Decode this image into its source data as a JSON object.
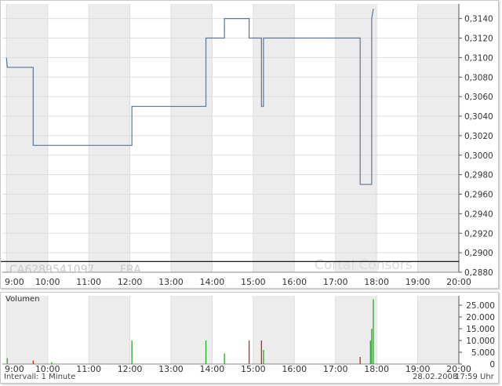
{
  "chart_data": [
    {
      "type": "line",
      "title": "",
      "identifier": "CA6289541097",
      "exchange": "FRA",
      "watermark": "Cortal Consors",
      "x_unit": "hours",
      "xlim": [
        8.9,
        20.0
      ],
      "ylim": [
        0.288,
        0.3155
      ],
      "x_tick_labels": [
        "9:00",
        "10:00",
        "11:00",
        "12:00",
        "13:00",
        "14:00",
        "15:00",
        "16:00",
        "17:00",
        "18:00",
        "19:00",
        "20:00"
      ],
      "y_tick_labels": [
        "0,2880",
        "0,2900",
        "0,2920",
        "0,2940",
        "0,2960",
        "0,2980",
        "0,3000",
        "0,3020",
        "0,3040",
        "0,3060",
        "0,3080",
        "0,3100",
        "0,3120",
        "0,3140"
      ],
      "reference_line": 0.2891,
      "grid": true,
      "series": [
        {
          "color": "#5b7596",
          "x": [
            9.0,
            9.02,
            9.65,
            9.65,
            12.05,
            12.05,
            13.85,
            13.85,
            14.3,
            14.3,
            14.9,
            14.9,
            15.2,
            15.2,
            15.25,
            15.25,
            17.6,
            17.6,
            17.88,
            17.88,
            17.92
          ],
          "y": [
            0.31,
            0.309,
            0.309,
            0.301,
            0.301,
            0.305,
            0.305,
            0.312,
            0.312,
            0.314,
            0.314,
            0.312,
            0.312,
            0.305,
            0.305,
            0.312,
            0.312,
            0.297,
            0.297,
            0.314,
            0.315
          ]
        }
      ]
    },
    {
      "type": "bar",
      "title": "Volumen",
      "xlim": [
        8.9,
        20.0
      ],
      "ylim": [
        0,
        29000
      ],
      "y_tick_labels": [
        "0",
        "5.000",
        "10.000",
        "15.000",
        "20.000",
        "25.000"
      ],
      "x_tick_labels": [
        "9:00",
        "10:00",
        "11:00",
        "12:00",
        "13:00",
        "14:00",
        "15:00",
        "16:00",
        "17:00",
        "18:00",
        "19:00",
        "20:00"
      ],
      "colors": {
        "up": "#22aa22",
        "down": "#cc2222"
      },
      "bars": [
        {
          "x": 9.02,
          "value": 2500,
          "dir": "up"
        },
        {
          "x": 9.65,
          "value": 1500,
          "dir": "down"
        },
        {
          "x": 10.1,
          "value": 800,
          "dir": "up"
        },
        {
          "x": 12.05,
          "value": 10000,
          "dir": "up"
        },
        {
          "x": 13.85,
          "value": 10000,
          "dir": "up"
        },
        {
          "x": 14.3,
          "value": 4500,
          "dir": "up"
        },
        {
          "x": 14.9,
          "value": 10000,
          "dir": "down"
        },
        {
          "x": 15.2,
          "value": 10000,
          "dir": "down"
        },
        {
          "x": 15.25,
          "value": 6000,
          "dir": "up"
        },
        {
          "x": 17.6,
          "value": 3000,
          "dir": "down"
        },
        {
          "x": 17.85,
          "value": 10000,
          "dir": "up"
        },
        {
          "x": 17.88,
          "value": 15000,
          "dir": "up"
        },
        {
          "x": 17.92,
          "value": 27500,
          "dir": "up"
        }
      ]
    }
  ],
  "footer": {
    "interval": "Intervall: 1 Minute",
    "date": "28.02.2008",
    "time": "17:59 Uhr"
  }
}
